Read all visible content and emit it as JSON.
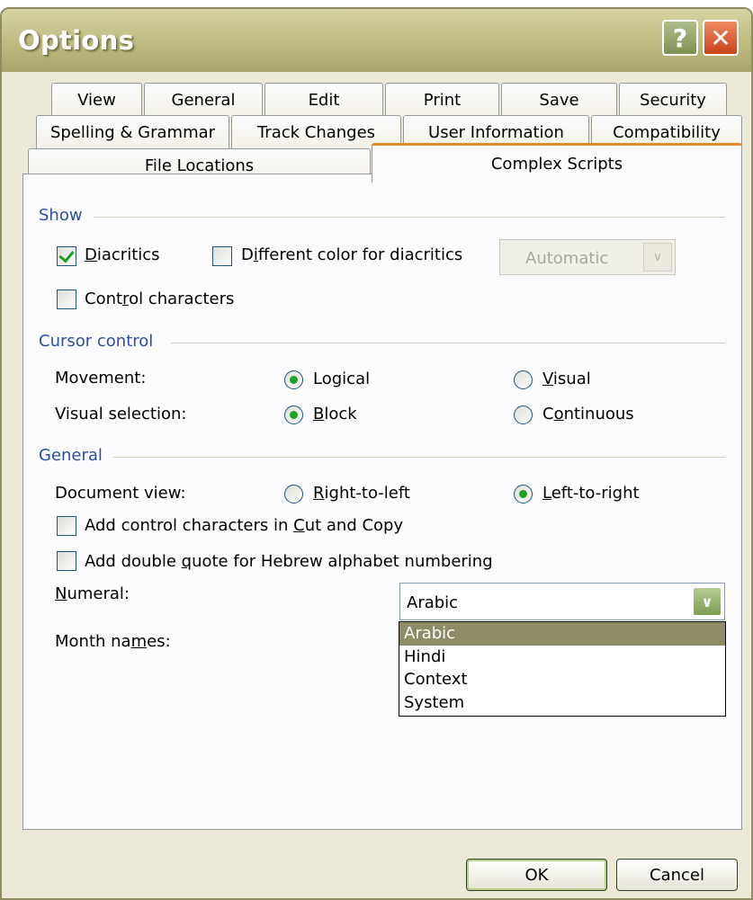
{
  "window": {
    "title": "Options"
  },
  "title_buttons": {
    "help": "?",
    "close": "✕"
  },
  "tabs_row1": [
    {
      "label": "View"
    },
    {
      "label": "General"
    },
    {
      "label": "Edit"
    },
    {
      "label": "Print"
    },
    {
      "label": "Save"
    },
    {
      "label": "Security"
    }
  ],
  "tabs_row2": [
    {
      "label": "Spelling & Grammar"
    },
    {
      "label": "Track Changes"
    },
    {
      "label": "User Information"
    },
    {
      "label": "Compatibility"
    }
  ],
  "tabs_row3": [
    {
      "label": "File Locations"
    },
    {
      "label": "Complex Scripts",
      "selected": true
    }
  ],
  "show": {
    "heading": "Show",
    "diacritics": {
      "label": "Diacritics",
      "checked": true
    },
    "different_color": {
      "label": "Different color for diacritics",
      "checked": false
    },
    "color_combo": {
      "value": "Automatic",
      "disabled": true
    },
    "control_chars": {
      "label": "Control characters",
      "checked": false
    }
  },
  "cursor": {
    "heading": "Cursor control",
    "movement": {
      "label": "Movement:",
      "options": [
        "Logical",
        "Visual"
      ],
      "selected": "Logical"
    },
    "visual_selection": {
      "label": "Visual selection:",
      "options": [
        "Block",
        "Continuous"
      ],
      "selected": "Block"
    }
  },
  "general": {
    "heading": "General",
    "document_view": {
      "label": "Document view:",
      "options": [
        "Right-to-left",
        "Left-to-right"
      ],
      "selected": "Left-to-right"
    },
    "add_control": {
      "label": "Add control characters in Cut and Copy",
      "checked": false
    },
    "add_quote": {
      "label": "Add double quote for Hebrew alphabet numbering",
      "checked": false
    },
    "numeral": {
      "label": "Numeral:",
      "value": "Arabic",
      "dropdown_options": [
        "Arabic",
        "Hindi",
        "Context",
        "System"
      ],
      "highlighted": "Arabic"
    },
    "month_names": {
      "label": "Month names:"
    }
  },
  "buttons": {
    "ok": "OK",
    "cancel": "Cancel"
  },
  "colors": {
    "accent_tab": "#e68b2c",
    "group_heading": "#2c4e9e",
    "check": "#21a121",
    "highlight": "#8e8b67"
  }
}
